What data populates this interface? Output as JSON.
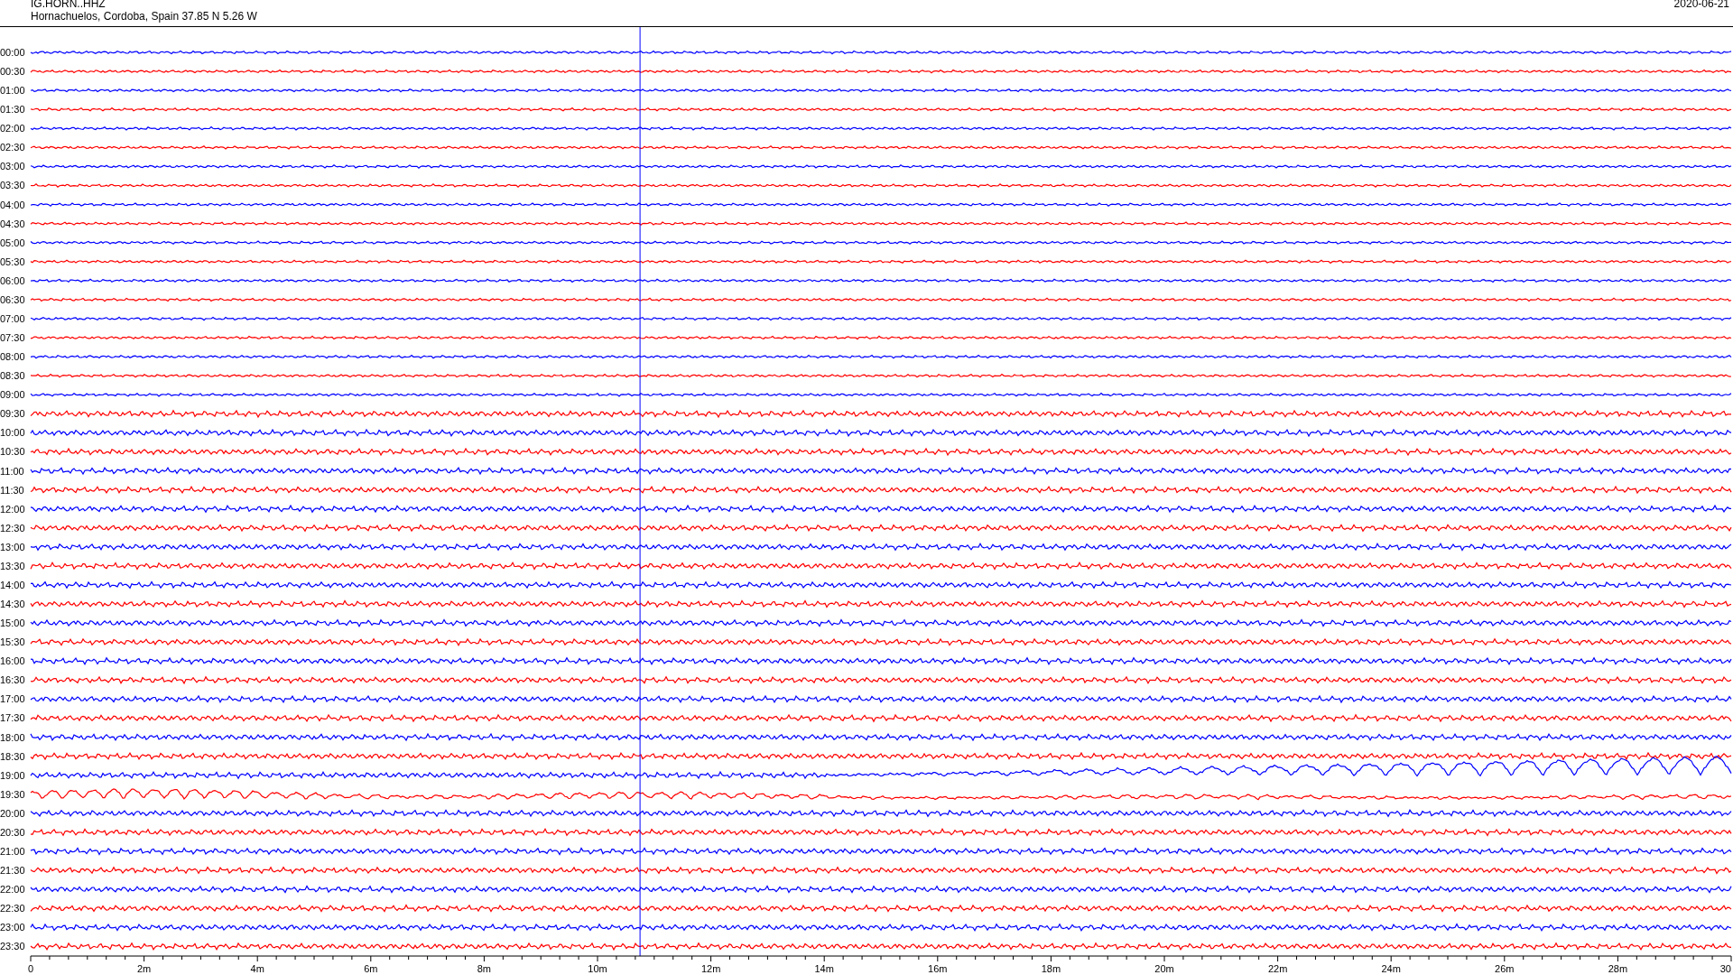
{
  "header": {
    "station": "IG.HORN..HHZ",
    "location": "Hornachuelos, Cordoba, Spain  37.85 N 5.26 W",
    "date": "2020-06-21"
  },
  "rows": [
    {
      "label": "00:00",
      "color": "#0000ff",
      "kind": "calm"
    },
    {
      "label": "00:30",
      "color": "#ff0000",
      "kind": "calm"
    },
    {
      "label": "01:00",
      "color": "#0000ff",
      "kind": "calm"
    },
    {
      "label": "01:30",
      "color": "#ff0000",
      "kind": "calm"
    },
    {
      "label": "02:00",
      "color": "#0000ff",
      "kind": "calm"
    },
    {
      "label": "02:30",
      "color": "#ff0000",
      "kind": "calm"
    },
    {
      "label": "03:00",
      "color": "#0000ff",
      "kind": "calm"
    },
    {
      "label": "03:30",
      "color": "#ff0000",
      "kind": "calm"
    },
    {
      "label": "04:00",
      "color": "#0000ff",
      "kind": "calm"
    },
    {
      "label": "04:30",
      "color": "#ff0000",
      "kind": "calm"
    },
    {
      "label": "05:00",
      "color": "#0000ff",
      "kind": "calm"
    },
    {
      "label": "05:30",
      "color": "#ff0000",
      "kind": "calm"
    },
    {
      "label": "06:00",
      "color": "#0000ff",
      "kind": "calm"
    },
    {
      "label": "06:30",
      "color": "#ff0000",
      "kind": "calm"
    },
    {
      "label": "07:00",
      "color": "#0000ff",
      "kind": "calm"
    },
    {
      "label": "07:30",
      "color": "#ff0000",
      "kind": "calm"
    },
    {
      "label": "08:00",
      "color": "#0000ff",
      "kind": "calm"
    },
    {
      "label": "08:30",
      "color": "#ff0000",
      "kind": "calm"
    },
    {
      "label": "09:00",
      "color": "#0000ff",
      "kind": "calm"
    },
    {
      "label": "09:30",
      "color": "#ff0000",
      "kind": "noisy"
    },
    {
      "label": "10:00",
      "color": "#0000ff",
      "kind": "noisy"
    },
    {
      "label": "10:30",
      "color": "#ff0000",
      "kind": "noisy"
    },
    {
      "label": "11:00",
      "color": "#0000ff",
      "kind": "noisy"
    },
    {
      "label": "11:30",
      "color": "#ff0000",
      "kind": "noisy"
    },
    {
      "label": "12:00",
      "color": "#0000ff",
      "kind": "noisy"
    },
    {
      "label": "12:30",
      "color": "#ff0000",
      "kind": "noisy"
    },
    {
      "label": "13:00",
      "color": "#0000ff",
      "kind": "noisy"
    },
    {
      "label": "13:30",
      "color": "#ff0000",
      "kind": "noisy"
    },
    {
      "label": "14:00",
      "color": "#0000ff",
      "kind": "noisy"
    },
    {
      "label": "14:30",
      "color": "#ff0000",
      "kind": "noisy"
    },
    {
      "label": "15:00",
      "color": "#0000ff",
      "kind": "noisy"
    },
    {
      "label": "15:30",
      "color": "#ff0000",
      "kind": "noisy"
    },
    {
      "label": "16:00",
      "color": "#0000ff",
      "kind": "noisy"
    },
    {
      "label": "16:30",
      "color": "#ff0000",
      "kind": "noisy"
    },
    {
      "label": "17:00",
      "color": "#0000ff",
      "kind": "noisy"
    },
    {
      "label": "17:30",
      "color": "#ff0000",
      "kind": "noisy"
    },
    {
      "label": "18:00",
      "color": "#0000ff",
      "kind": "noisy"
    },
    {
      "label": "18:30",
      "color": "#ff0000",
      "kind": "noisy"
    },
    {
      "label": "19:00",
      "color": "#0000ff",
      "kind": "swell"
    },
    {
      "label": "19:30",
      "color": "#ff0000",
      "kind": "quake"
    },
    {
      "label": "20:00",
      "color": "#0000ff",
      "kind": "noisy"
    },
    {
      "label": "20:30",
      "color": "#ff0000",
      "kind": "noisy"
    },
    {
      "label": "21:00",
      "color": "#0000ff",
      "kind": "noisy"
    },
    {
      "label": "21:30",
      "color": "#ff0000",
      "kind": "noisy"
    },
    {
      "label": "22:00",
      "color": "#0000ff",
      "kind": "noisy"
    },
    {
      "label": "22:30",
      "color": "#ff0000",
      "kind": "noisy"
    },
    {
      "label": "23:00",
      "color": "#0000ff",
      "kind": "noisy"
    },
    {
      "label": "23:30",
      "color": "#ff0000",
      "kind": "noisy"
    }
  ],
  "x_axis": {
    "ticks": [
      "0",
      "2m",
      "4m",
      "6m",
      "8m",
      "10m",
      "12m",
      "14m",
      "16m",
      "18m",
      "20m",
      "22m",
      "24m",
      "26m",
      "28m",
      "30"
    ]
  }
}
